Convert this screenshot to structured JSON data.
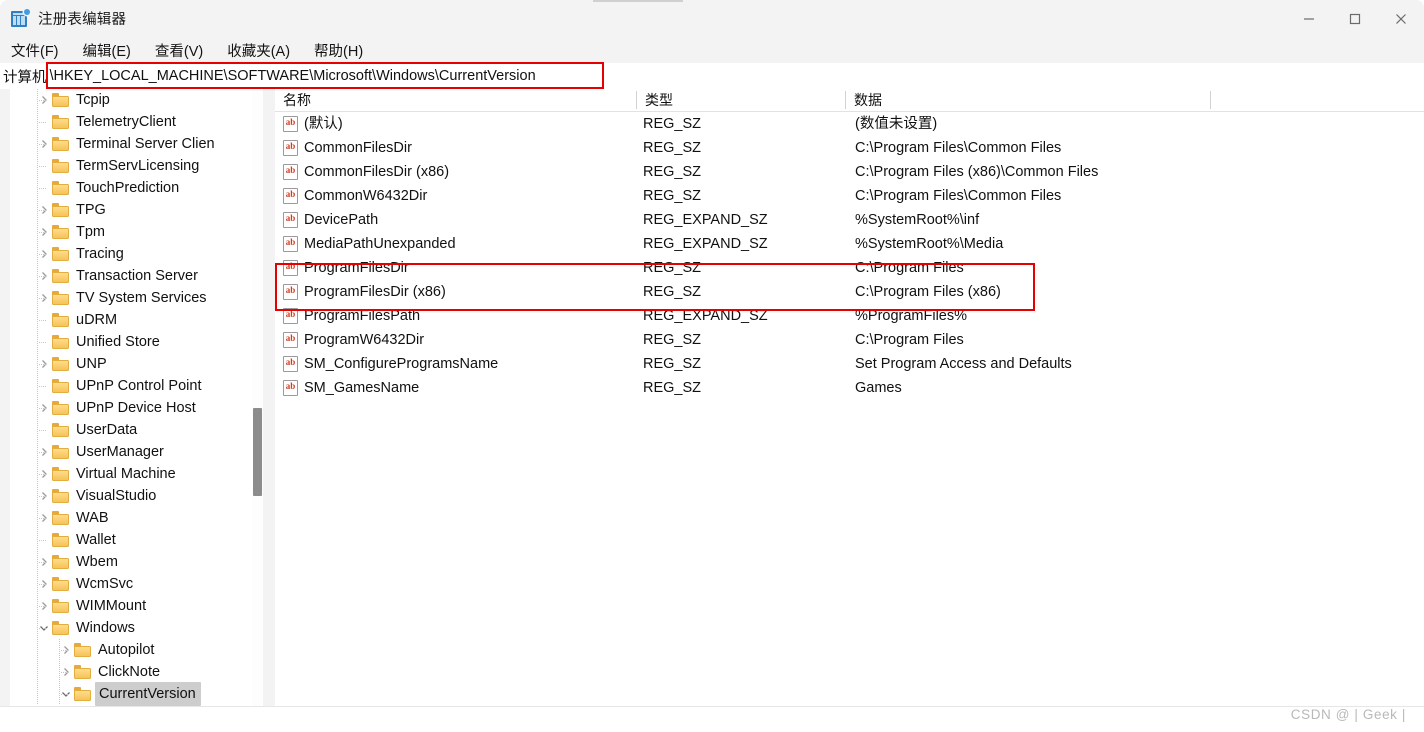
{
  "window": {
    "title": "注册表编辑器",
    "icon": "registry-editor-icon",
    "controls": {
      "minimize": "—",
      "maximize": "□",
      "close": "✕"
    }
  },
  "menubar": {
    "items": [
      {
        "label": "文件(F)",
        "name": "menu-file"
      },
      {
        "label": "编辑(E)",
        "name": "menu-edit"
      },
      {
        "label": "查看(V)",
        "name": "menu-view"
      },
      {
        "label": "收藏夹(A)",
        "name": "menu-favorites"
      },
      {
        "label": "帮助(H)",
        "name": "menu-help"
      }
    ]
  },
  "address": {
    "root_label": "计算机",
    "path": "\\HKEY_LOCAL_MACHINE\\SOFTWARE\\Microsoft\\Windows\\CurrentVersion",
    "highlight_color": "#e60000"
  },
  "tree": {
    "items": [
      {
        "label": "Tcpip",
        "depth": 1,
        "expandable": true,
        "expanded": false,
        "selected": false
      },
      {
        "label": "TelemetryClient",
        "depth": 1,
        "expandable": false,
        "expanded": false,
        "selected": false
      },
      {
        "label": "Terminal Server Clien",
        "depth": 1,
        "expandable": true,
        "expanded": false,
        "selected": false
      },
      {
        "label": "TermServLicensing",
        "depth": 1,
        "expandable": false,
        "expanded": false,
        "selected": false
      },
      {
        "label": "TouchPrediction",
        "depth": 1,
        "expandable": false,
        "expanded": false,
        "selected": false
      },
      {
        "label": "TPG",
        "depth": 1,
        "expandable": true,
        "expanded": false,
        "selected": false
      },
      {
        "label": "Tpm",
        "depth": 1,
        "expandable": true,
        "expanded": false,
        "selected": false
      },
      {
        "label": "Tracing",
        "depth": 1,
        "expandable": true,
        "expanded": false,
        "selected": false
      },
      {
        "label": "Transaction Server",
        "depth": 1,
        "expandable": true,
        "expanded": false,
        "selected": false
      },
      {
        "label": "TV System Services",
        "depth": 1,
        "expandable": true,
        "expanded": false,
        "selected": false
      },
      {
        "label": "uDRM",
        "depth": 1,
        "expandable": false,
        "expanded": false,
        "selected": false
      },
      {
        "label": "Unified Store",
        "depth": 1,
        "expandable": false,
        "expanded": false,
        "selected": false
      },
      {
        "label": "UNP",
        "depth": 1,
        "expandable": true,
        "expanded": false,
        "selected": false
      },
      {
        "label": "UPnP Control Point",
        "depth": 1,
        "expandable": false,
        "expanded": false,
        "selected": false
      },
      {
        "label": "UPnP Device Host",
        "depth": 1,
        "expandable": true,
        "expanded": false,
        "selected": false
      },
      {
        "label": "UserData",
        "depth": 1,
        "expandable": false,
        "expanded": false,
        "selected": false
      },
      {
        "label": "UserManager",
        "depth": 1,
        "expandable": true,
        "expanded": false,
        "selected": false
      },
      {
        "label": "Virtual Machine",
        "depth": 1,
        "expandable": true,
        "expanded": false,
        "selected": false
      },
      {
        "label": "VisualStudio",
        "depth": 1,
        "expandable": true,
        "expanded": false,
        "selected": false
      },
      {
        "label": "WAB",
        "depth": 1,
        "expandable": true,
        "expanded": false,
        "selected": false
      },
      {
        "label": "Wallet",
        "depth": 1,
        "expandable": false,
        "expanded": false,
        "selected": false
      },
      {
        "label": "Wbem",
        "depth": 1,
        "expandable": true,
        "expanded": false,
        "selected": false
      },
      {
        "label": "WcmSvc",
        "depth": 1,
        "expandable": true,
        "expanded": false,
        "selected": false
      },
      {
        "label": "WIMMount",
        "depth": 1,
        "expandable": true,
        "expanded": false,
        "selected": false
      },
      {
        "label": "Windows",
        "depth": 1,
        "expandable": true,
        "expanded": true,
        "selected": false
      },
      {
        "label": "Autopilot",
        "depth": 2,
        "expandable": true,
        "expanded": false,
        "selected": false
      },
      {
        "label": "ClickNote",
        "depth": 2,
        "expandable": true,
        "expanded": false,
        "selected": false
      },
      {
        "label": "CurrentVersion",
        "depth": 2,
        "expandable": true,
        "expanded": true,
        "selected": true
      }
    ]
  },
  "list": {
    "columns": [
      {
        "label": "名称",
        "name": "column-name"
      },
      {
        "label": "类型",
        "name": "column-type"
      },
      {
        "label": "数据",
        "name": "column-data"
      }
    ],
    "rows": [
      {
        "name": "(默认)",
        "type": "REG_SZ",
        "data": "(数值未设置)",
        "highlighted": false
      },
      {
        "name": "CommonFilesDir",
        "type": "REG_SZ",
        "data": "C:\\Program Files\\Common Files",
        "highlighted": false
      },
      {
        "name": "CommonFilesDir (x86)",
        "type": "REG_SZ",
        "data": "C:\\Program Files (x86)\\Common Files",
        "highlighted": false
      },
      {
        "name": "CommonW6432Dir",
        "type": "REG_SZ",
        "data": "C:\\Program Files\\Common Files",
        "highlighted": false
      },
      {
        "name": "DevicePath",
        "type": "REG_EXPAND_SZ",
        "data": "%SystemRoot%\\inf",
        "highlighted": false
      },
      {
        "name": "MediaPathUnexpanded",
        "type": "REG_EXPAND_SZ",
        "data": "%SystemRoot%\\Media",
        "highlighted": false
      },
      {
        "name": "ProgramFilesDir",
        "type": "REG_SZ",
        "data": "C:\\Program Files",
        "highlighted": true
      },
      {
        "name": "ProgramFilesDir (x86)",
        "type": "REG_SZ",
        "data": "C:\\Program Files (x86)",
        "highlighted": true
      },
      {
        "name": "ProgramFilesPath",
        "type": "REG_EXPAND_SZ",
        "data": "%ProgramFiles%",
        "highlighted": false
      },
      {
        "name": "ProgramW6432Dir",
        "type": "REG_SZ",
        "data": "C:\\Program Files",
        "highlighted": false
      },
      {
        "name": "SM_ConfigureProgramsName",
        "type": "REG_SZ",
        "data": "Set Program Access and Defaults",
        "highlighted": false
      },
      {
        "name": "SM_GamesName",
        "type": "REG_SZ",
        "data": "Games",
        "highlighted": false
      }
    ]
  },
  "status": {
    "watermark": "CSDN @ | Geek |"
  }
}
